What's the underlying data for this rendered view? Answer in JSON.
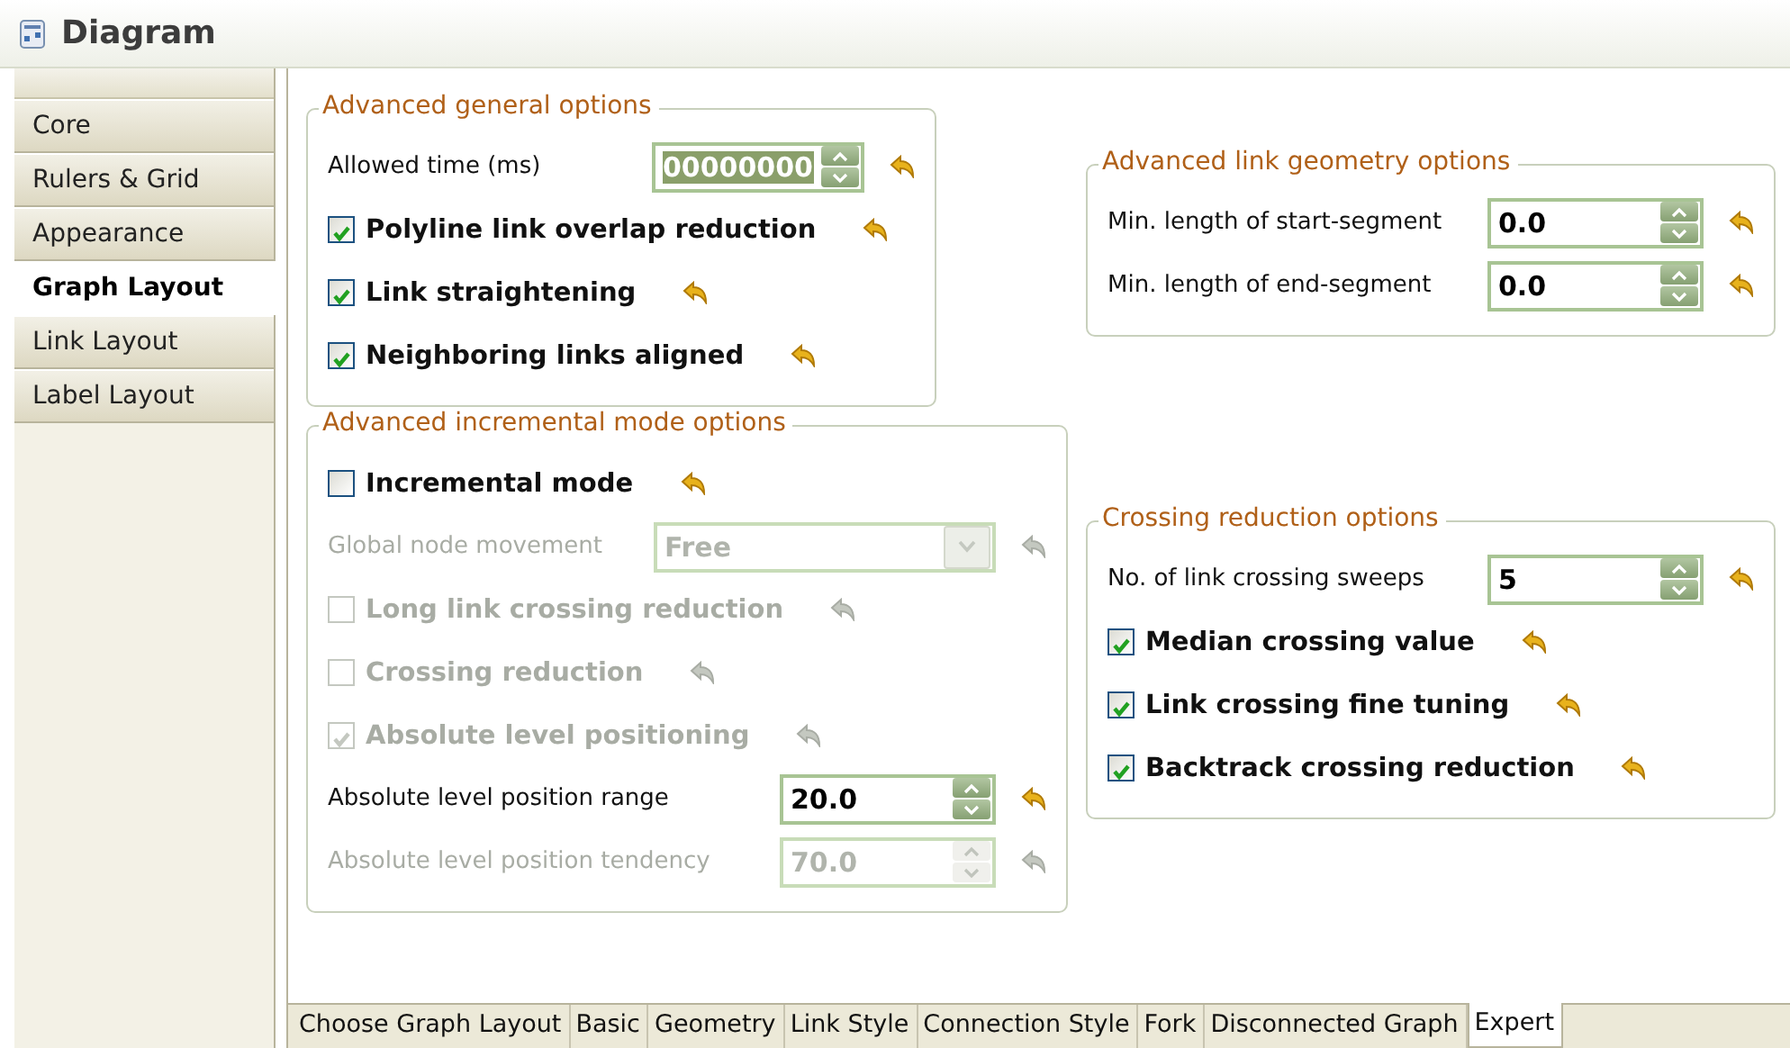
{
  "window": {
    "title": "Diagram"
  },
  "sidebar": {
    "items": [
      {
        "label": "Core",
        "selected": false
      },
      {
        "label": "Rulers & Grid",
        "selected": false
      },
      {
        "label": "Appearance",
        "selected": false
      },
      {
        "label": "Graph Layout",
        "selected": true
      },
      {
        "label": "Link Layout",
        "selected": false
      },
      {
        "label": "Label Layout",
        "selected": false
      }
    ]
  },
  "columns": [
    {
      "groups": [
        {
          "title": "Advanced general options",
          "rows": [
            {
              "kind": "spinner",
              "label": "Allowed time (ms)",
              "value": "00000000",
              "highlighted": true,
              "disabled": false
            },
            {
              "kind": "checkbox",
              "label": "Polyline link overlap reduction",
              "checked": true,
              "disabled": false
            },
            {
              "kind": "checkbox",
              "label": "Link straightening",
              "checked": true,
              "disabled": false
            },
            {
              "kind": "checkbox",
              "label": "Neighboring links aligned",
              "checked": true,
              "disabled": false
            }
          ]
        },
        {
          "title": "Advanced incremental mode options",
          "rows": [
            {
              "kind": "checkbox",
              "label": "Incremental mode",
              "checked": false,
              "disabled": false
            },
            {
              "kind": "combo",
              "label": "Global node movement",
              "value": "Free",
              "disabled": true
            },
            {
              "kind": "checkbox",
              "label": "Long link crossing reduction",
              "checked": false,
              "disabled": true
            },
            {
              "kind": "checkbox",
              "label": "Crossing reduction",
              "checked": false,
              "disabled": true
            },
            {
              "kind": "checkbox",
              "label": "Absolute level positioning",
              "checked": true,
              "disabled": true
            },
            {
              "kind": "spinner",
              "label": "Absolute level position range",
              "value": "20.0",
              "highlighted": false,
              "disabled": false
            },
            {
              "kind": "spinner",
              "label": "Absolute level position tendency",
              "value": "70.0",
              "highlighted": false,
              "disabled": true
            }
          ]
        }
      ]
    },
    {
      "groups": [
        {
          "title": "Advanced link geometry options",
          "rows": [
            {
              "kind": "spinner",
              "label": "Min. length of start-segment",
              "value": "0.0",
              "highlighted": false,
              "disabled": false
            },
            {
              "kind": "spinner",
              "label": "Min. length of end-segment",
              "value": "0.0",
              "highlighted": false,
              "disabled": false
            }
          ]
        },
        {
          "title": "Crossing reduction options",
          "rows": [
            {
              "kind": "spinner",
              "label": "No. of link crossing sweeps",
              "value": "5",
              "highlighted": false,
              "disabled": false
            },
            {
              "kind": "checkbox",
              "label": "Median crossing value",
              "checked": true,
              "disabled": false
            },
            {
              "kind": "checkbox",
              "label": "Link crossing fine tuning",
              "checked": true,
              "disabled": false
            },
            {
              "kind": "checkbox",
              "label": "Backtrack crossing reduction",
              "checked": true,
              "disabled": false
            }
          ]
        }
      ]
    }
  ],
  "bottom_tabs": [
    {
      "label": "Choose Graph Layout",
      "selected": false
    },
    {
      "label": "Basic",
      "selected": false
    },
    {
      "label": "Geometry",
      "selected": false
    },
    {
      "label": "Link Style",
      "selected": false
    },
    {
      "label": "Connection Style",
      "selected": false
    },
    {
      "label": "Fork",
      "selected": false
    },
    {
      "label": "Disconnected Graph",
      "selected": false
    },
    {
      "label": "Expert",
      "selected": true
    }
  ]
}
